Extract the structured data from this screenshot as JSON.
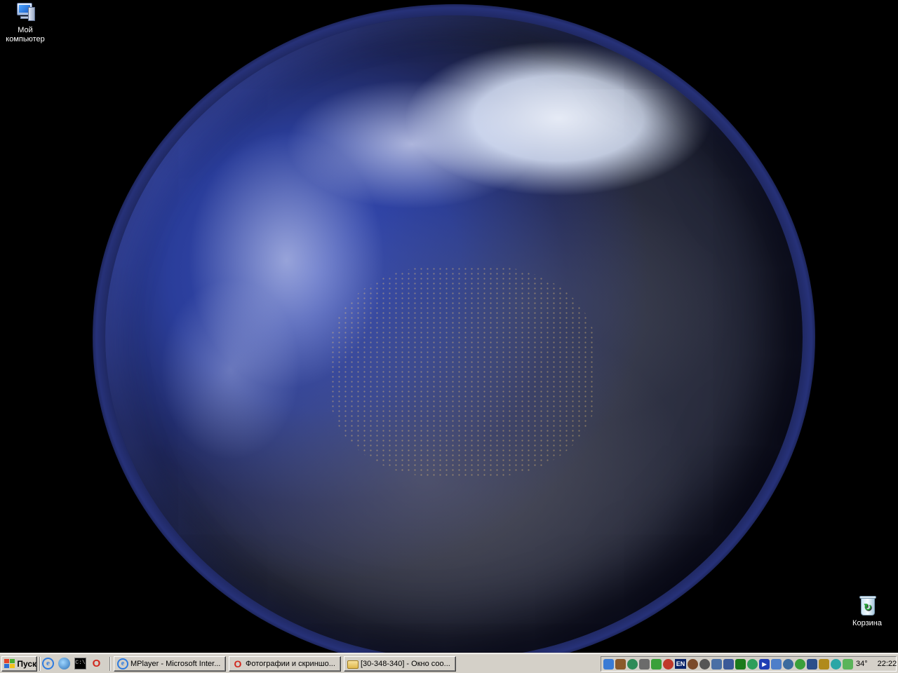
{
  "desktop": {
    "icons": [
      {
        "label": "Мой компьютер",
        "icon": "my-computer-icon"
      },
      {
        "label": "Корзина",
        "icon": "recycle-bin-icon"
      }
    ]
  },
  "taskbar": {
    "start_label": "Пуск",
    "quick_launch": [
      {
        "icon": "internet-explorer-icon"
      },
      {
        "icon": "media-player-icon"
      },
      {
        "icon": "command-prompt-icon",
        "text": "C:\\"
      },
      {
        "icon": "opera-icon",
        "text": "O"
      }
    ],
    "tasks": [
      {
        "label": "MPlayer - Microsoft Inter...",
        "icon": "internet-explorer-icon"
      },
      {
        "label": "Фотографии и скриншо...",
        "icon": "opera-icon"
      },
      {
        "label": "[30-348-340] - Окно соо...",
        "icon": "folder-icon"
      }
    ],
    "tray": {
      "icons": [
        {
          "name": "network-icon",
          "color": "#3a7bd5"
        },
        {
          "name": "tools-icon",
          "color": "#8a5a2b"
        },
        {
          "name": "globe-icon",
          "color": "#2e8b57"
        },
        {
          "name": "wrench-icon",
          "color": "#6b6b6b"
        },
        {
          "name": "puzzle-icon",
          "color": "#3aa03a"
        }
      ],
      "language": "EN",
      "icons_after": [
        {
          "name": "antivirus-icon",
          "color": "#c0392b"
        },
        {
          "name": "disk-icon",
          "color": "#7b4a2a"
        },
        {
          "name": "sync-icon",
          "color": "#555555"
        },
        {
          "name": "monitor-icon",
          "color": "#4a6fa5"
        },
        {
          "name": "printer-icon",
          "color": "#3b5998"
        },
        {
          "name": "chip-icon",
          "color": "#1b7a1b"
        },
        {
          "name": "user-icon",
          "color": "#2e9e5b"
        },
        {
          "name": "play-icon",
          "color": "#1f3fb5"
        },
        {
          "name": "window-icon",
          "color": "#4d7ec9"
        },
        {
          "name": "shield-icon",
          "color": "#3b6b9e"
        },
        {
          "name": "messenger-icon",
          "color": "#3aa03a"
        },
        {
          "name": "battery-icon",
          "color": "#2b4f8a"
        },
        {
          "name": "torrent-icon",
          "color": "#b08a1b"
        },
        {
          "name": "refresh-icon",
          "color": "#2aa6a6"
        },
        {
          "name": "weather-icon",
          "color": "#5ab45a"
        }
      ],
      "temperature": "34°",
      "clock": "22:22"
    }
  }
}
